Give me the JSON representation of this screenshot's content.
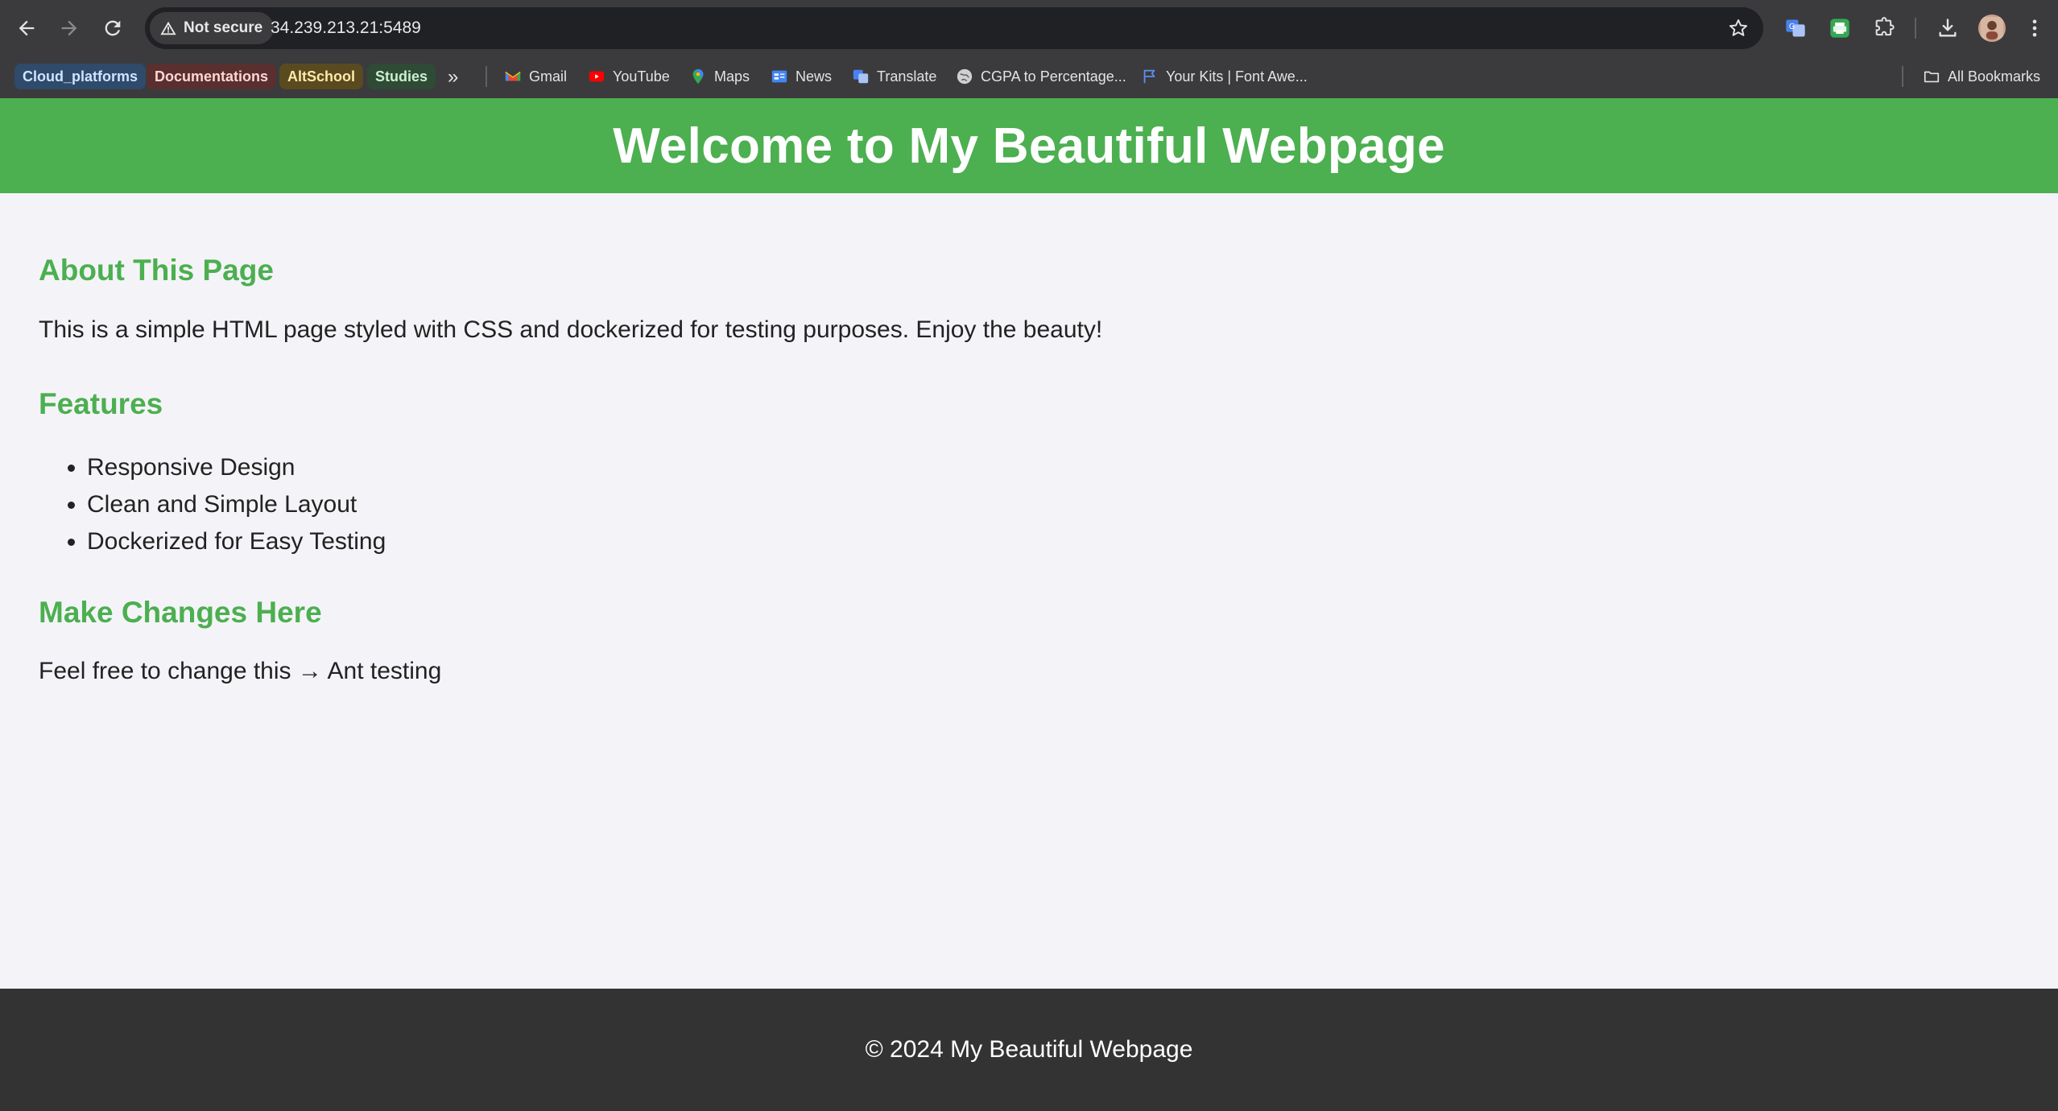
{
  "browser": {
    "security_label": "Not secure",
    "url": "34.239.213.21:5489",
    "bookmark_groups": [
      {
        "label": "Cloud_platforms",
        "bg": "#2f4a6b",
        "fg": "#cfe3ff"
      },
      {
        "label": "Documentations",
        "bg": "#5a2f2f",
        "fg": "#ffd6d2"
      },
      {
        "label": "AltSchool",
        "bg": "#5a4a1f",
        "fg": "#ffe9a8"
      },
      {
        "label": "Studies",
        "bg": "#2f4a35",
        "fg": "#c8f0cf"
      }
    ],
    "bookmarks": [
      {
        "label": "Gmail",
        "icon": "gmail-icon"
      },
      {
        "label": "YouTube",
        "icon": "youtube-icon"
      },
      {
        "label": "Maps",
        "icon": "maps-icon"
      },
      {
        "label": "News",
        "icon": "news-icon"
      },
      {
        "label": "Translate",
        "icon": "translate-icon"
      },
      {
        "label": "CGPA to Percentage...",
        "icon": "globe-icon"
      },
      {
        "label": "Your Kits | Font Awe...",
        "icon": "flag-icon"
      }
    ],
    "all_bookmarks_label": "All Bookmarks"
  },
  "page": {
    "header_title": "Welcome to My Beautiful Webpage",
    "about_heading": "About This Page",
    "about_text": "This is a simple HTML page styled with CSS and dockerized for testing purposes. Enjoy the beauty!",
    "features_heading": "Features",
    "features": [
      "Responsive Design",
      "Clean and Simple Layout",
      "Dockerized for Easy Testing"
    ],
    "changes_heading": "Make Changes Here",
    "changes_text": "Feel free to change this → Ant testing",
    "footer_text": "© 2024 My Beautiful Webpage"
  },
  "colors": {
    "accent": "#4caf50",
    "footer_bg": "#333333",
    "page_bg": "#f4f4f8",
    "chrome_bg": "#3b3b3d"
  }
}
